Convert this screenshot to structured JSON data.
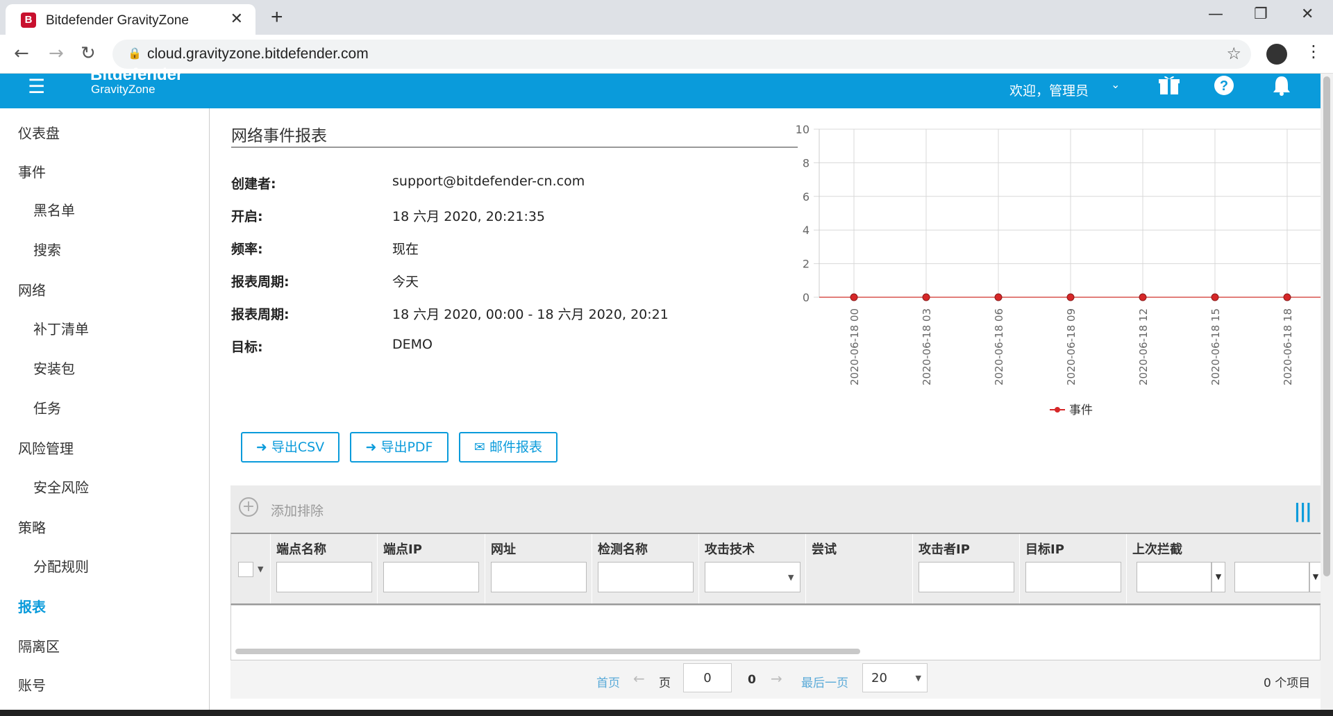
{
  "browser": {
    "tab_title": "Bitdefender GravityZone",
    "favicon_letter": "B",
    "url": "cloud.gravityzone.bitdefender.com"
  },
  "appbar": {
    "logo_top": "Bitdefender",
    "logo_bottom": "GravityZone",
    "welcome": "欢迎，管理员"
  },
  "sidebar": {
    "items": [
      {
        "label": "仪表盘"
      },
      {
        "label": "事件"
      },
      {
        "label": "黑名单"
      },
      {
        "label": "搜索"
      },
      {
        "label": "网络"
      },
      {
        "label": "补丁清单"
      },
      {
        "label": "安装包"
      },
      {
        "label": "任务"
      },
      {
        "label": "风险管理"
      },
      {
        "label": "安全风险"
      },
      {
        "label": "策略"
      },
      {
        "label": "分配规则"
      },
      {
        "label": "报表"
      },
      {
        "label": "隔离区"
      },
      {
        "label": "账号"
      }
    ]
  },
  "report": {
    "title": "网络事件报表",
    "fields": [
      {
        "label": "创建者:",
        "value": "support@bitdefender-cn.com"
      },
      {
        "label": "开启:",
        "value": "18 六月 2020, 20:21:35"
      },
      {
        "label": "频率:",
        "value": "现在"
      },
      {
        "label": "报表周期:",
        "value": "今天"
      },
      {
        "label": "报表周期:",
        "value": "18 六月 2020, 00:00 - 18 六月 2020, 20:21"
      },
      {
        "label": "目标:",
        "value": "DEMO"
      }
    ]
  },
  "actions": {
    "export_csv": "导出CSV",
    "export_pdf": "导出PDF",
    "email_report": "邮件报表"
  },
  "grid": {
    "add_exclusion": "添加排除",
    "columns": [
      "端点名称",
      "端点IP",
      "网址",
      "检测名称",
      "攻击技术",
      "尝试",
      "攻击者IP",
      "目标IP",
      "上次拦截"
    ]
  },
  "pager": {
    "first": "首页",
    "page_label": "页",
    "page_value": "0",
    "total_pages": "0",
    "last": "最后一页",
    "page_size": "20",
    "item_count": "0 个项目"
  },
  "chart_data": {
    "type": "line",
    "x": [
      "2020-06-18 00",
      "2020-06-18 03",
      "2020-06-18 06",
      "2020-06-18 09",
      "2020-06-18 12",
      "2020-06-18 15",
      "2020-06-18 18"
    ],
    "series": [
      {
        "name": "事件",
        "values": [
          0,
          0,
          0,
          0,
          0,
          0,
          0
        ]
      }
    ],
    "ylim": [
      0,
      10
    ],
    "yticks": [
      0,
      2,
      4,
      6,
      8,
      10
    ],
    "grid": true,
    "legend": "bottom",
    "color": "#d62728"
  }
}
